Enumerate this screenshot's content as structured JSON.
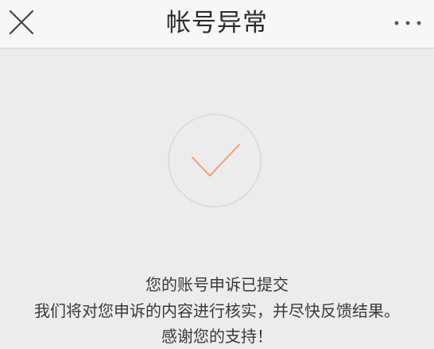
{
  "header": {
    "title": "帐号异常",
    "close_icon": "close-icon",
    "more_icon": "more-horizontal-icon"
  },
  "status": {
    "icon": "checkmark-icon",
    "accent_color": "#f2a47a",
    "circle_color": "#d9d9d9"
  },
  "message": {
    "line1": "您的账号申诉已提交",
    "line2": "我们将对您申诉的内容进行核实，并尽快反馈结果。",
    "line3": "感谢您的支持！"
  }
}
